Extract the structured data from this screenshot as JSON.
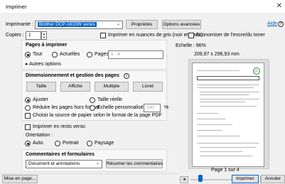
{
  "window": {
    "title": "Imprimer"
  },
  "top": {
    "printer_label": "Imprimante :",
    "printer_value": "Brother DCP-1610W series",
    "properties_button": "Propriétés",
    "advanced_button": "Options avancées",
    "help_link": "Aide",
    "copies_label": "Copies :",
    "copies_value": "1",
    "grayscale_label": "Imprimer en nuances de gris (noir et blanc)",
    "save_ink_label": "Economiser de l'encre/du toner"
  },
  "pages": {
    "heading": "Pages à imprimer",
    "all": "Tout",
    "current": "Actuelles",
    "pages": "Pages",
    "pages_placeholder": "1 - 4",
    "more_options": "Autres options"
  },
  "sizing": {
    "heading": "Dimensionnement et gestion des pages",
    "tabs": [
      "Taille",
      "Affiche",
      "Multiple",
      "Livret"
    ],
    "fit": "Ajuster",
    "actual_size": "Taille réelle",
    "shrink": "Réduire les pages hors format",
    "custom_scale": "Echelle personnalisée :",
    "custom_scale_value": "100",
    "percent": "%",
    "paper_source": "Choisir la source de papier selon le format de la page PDF"
  },
  "duplex": {
    "label": "Imprimer en recto verso"
  },
  "orientation": {
    "label": "Orientation :",
    "auto": "Auto.",
    "portrait": "Portrait",
    "landscape": "Paysage"
  },
  "comments": {
    "heading": "Commentaires et formulaires",
    "select_value": "Document et annotations",
    "summarize_button": "Résumer les commentaires"
  },
  "preview": {
    "scale": "Echelle : 96%",
    "size": "209,97 x 296,93 mm",
    "page_indicator": "Page 1 sur 4",
    "doc_badge": "DC"
  },
  "bottom": {
    "page_setup_button": "Mise en page...",
    "print_button": "Imprimer",
    "cancel_button": "Annuler"
  }
}
